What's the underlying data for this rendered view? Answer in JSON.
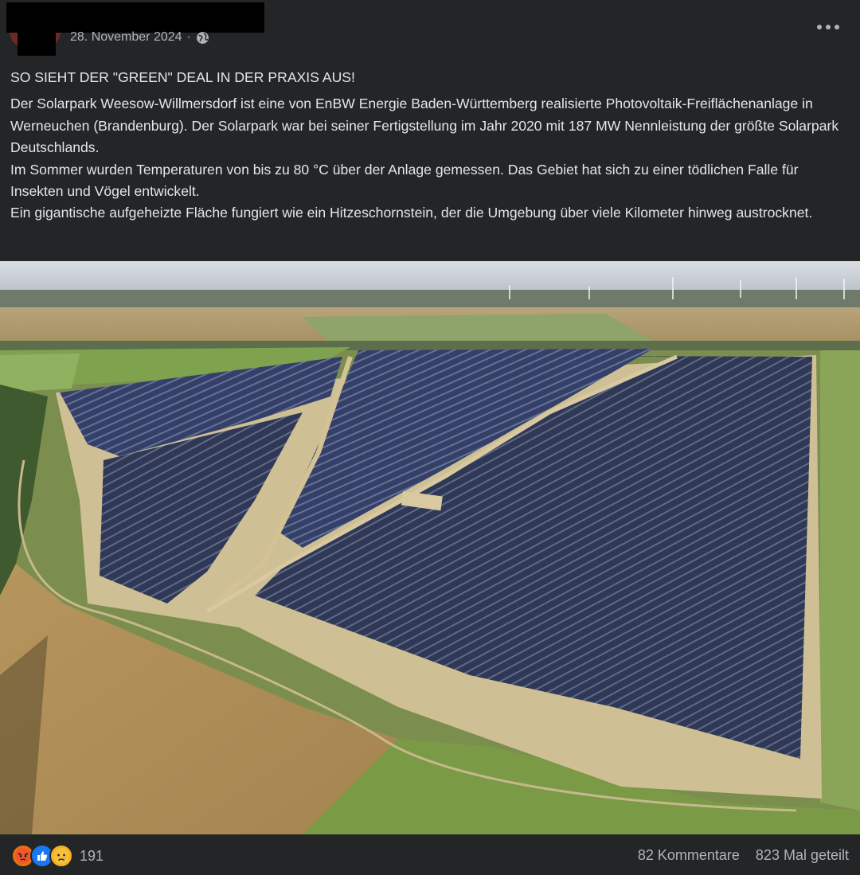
{
  "post": {
    "date": "28. November 2024",
    "separator": "·",
    "audience_icon": "globe-icon",
    "more_icon": "more-options-icon",
    "headline": "SO SIEHT DER \"GREEN\" DEAL IN DER PRAXIS AUS!",
    "paragraphs": [
      "Der Solarpark Weesow-Willmersdorf ist eine von EnBW Energie Baden-Württemberg realisierte Photovoltaik-Freiflächenanlage in Werneuchen (Brandenburg). Der Solarpark war bei seiner Fertigstellung im Jahr 2020 mit 187 MW Nennleistung der größte Solarpark Deutschlands.",
      "Im Sommer wurden Temperaturen von bis zu 80 °C über der Anlage gemessen. Das Gebiet hat sich zu einer tödlichen Falle für Insekten und Vögel entwickelt.",
      "Ein gigantische aufgeheizte Fläche fungiert wie ein Hitzeschornstein, der die Umgebung über viele Kilometer hinweg austrocknet."
    ]
  },
  "footer": {
    "reactions": [
      "angry-reaction-icon",
      "like-reaction-icon",
      "sad-reaction-icon"
    ],
    "reaction_count": "191",
    "comments": "82 Kommentare",
    "shares": "823 Mal geteilt"
  },
  "colors": {
    "background": "#242526",
    "text": "#e4e6eb",
    "secondary_text": "#b0b3b8",
    "angry": "#e9710f",
    "like": "#1877f2",
    "sad": "#f7b125"
  }
}
